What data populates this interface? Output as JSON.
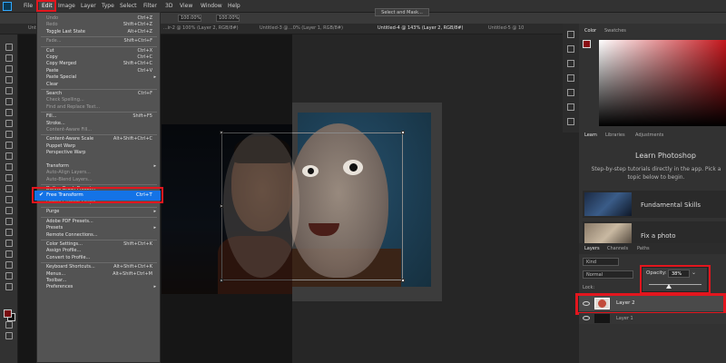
{
  "menubar": {
    "items": [
      "File",
      "Edit",
      "Image",
      "Layer",
      "Type",
      "Select",
      "Filter",
      "3D",
      "View",
      "Window",
      "Help"
    ]
  },
  "options": {
    "zoom_a": "100.00%",
    "zoom_b": "100.00%",
    "select_mask": "Select and Mask..."
  },
  "tabs": [
    {
      "label": "Untitl...",
      "active": false
    },
    {
      "label": "...ir-2 @ 100% (Layer 2, RGB/8#)",
      "active": false
    },
    {
      "label": "Untitled-3 @",
      "active": false
    },
    {
      "label": "...0% (Layer 1, RGB/8#)",
      "active": false
    },
    {
      "label": "Untitled-4 @ 143% (Layer 2, RGB/8#)",
      "active": true
    },
    {
      "label": "Untitled-5 @ 10",
      "active": false
    }
  ],
  "edit_menu": {
    "items": [
      {
        "label": "Undo",
        "shortcut": "Ctrl+Z",
        "dim": true
      },
      {
        "label": "Redo",
        "shortcut": "Shift+Ctrl+Z",
        "dim": true
      },
      {
        "label": "Toggle Last State",
        "shortcut": "Alt+Ctrl+Z",
        "dim": false
      },
      {
        "sep": true
      },
      {
        "label": "Fade...",
        "shortcut": "Shift+Ctrl+F",
        "dim": true
      },
      {
        "sep": true
      },
      {
        "label": "Cut",
        "shortcut": "Ctrl+X",
        "dim": false
      },
      {
        "label": "Copy",
        "shortcut": "Ctrl+C",
        "dim": false
      },
      {
        "label": "Copy Merged",
        "shortcut": "Shift+Ctrl+C",
        "dim": false
      },
      {
        "label": "Paste",
        "shortcut": "Ctrl+V",
        "dim": false
      },
      {
        "label": "Paste Special",
        "shortcut": "",
        "dim": false,
        "sub": true
      },
      {
        "label": "Clear",
        "shortcut": "",
        "dim": false
      },
      {
        "sep": true
      },
      {
        "label": "Search",
        "shortcut": "Ctrl+F",
        "dim": false
      },
      {
        "label": "Check Spelling...",
        "shortcut": "",
        "dim": true
      },
      {
        "label": "Find and Replace Text...",
        "shortcut": "",
        "dim": true
      },
      {
        "sep": true
      },
      {
        "label": "Fill...",
        "shortcut": "Shift+F5",
        "dim": false
      },
      {
        "label": "Stroke...",
        "shortcut": "",
        "dim": false
      },
      {
        "label": "Content-Aware Fill...",
        "shortcut": "",
        "dim": true
      },
      {
        "sep": true
      },
      {
        "label": "Content-Aware Scale",
        "shortcut": "Alt+Shift+Ctrl+C",
        "dim": false
      },
      {
        "label": "Puppet Warp",
        "shortcut": "",
        "dim": false
      },
      {
        "label": "Perspective Warp",
        "shortcut": "",
        "dim": false
      },
      {
        "label": "Free Transform",
        "shortcut": "Ctrl+T",
        "dim": false,
        "highlight": true
      },
      {
        "label": "Transform",
        "shortcut": "",
        "dim": false,
        "sub": true
      },
      {
        "label": "Auto-Align Layers...",
        "shortcut": "",
        "dim": true
      },
      {
        "label": "Auto-Blend Layers...",
        "shortcut": "",
        "dim": true
      },
      {
        "sep": true
      },
      {
        "label": "Define Brush Preset...",
        "shortcut": "",
        "dim": false
      },
      {
        "label": "Define Pattern...",
        "shortcut": "",
        "dim": false
      },
      {
        "label": "Define Custom Shape...",
        "shortcut": "",
        "dim": true
      },
      {
        "sep": true
      },
      {
        "label": "Purge",
        "shortcut": "",
        "dim": false,
        "sub": true
      },
      {
        "sep": true
      },
      {
        "label": "Adobe PDF Presets...",
        "shortcut": "",
        "dim": false
      },
      {
        "label": "Presets",
        "shortcut": "",
        "dim": false,
        "sub": true
      },
      {
        "label": "Remote Connections...",
        "shortcut": "",
        "dim": false
      },
      {
        "sep": true
      },
      {
        "label": "Color Settings...",
        "shortcut": "Shift+Ctrl+K",
        "dim": false
      },
      {
        "label": "Assign Profile...",
        "shortcut": "",
        "dim": false
      },
      {
        "label": "Convert to Profile...",
        "shortcut": "",
        "dim": false
      },
      {
        "sep": true
      },
      {
        "label": "Keyboard Shortcuts...",
        "shortcut": "Alt+Shift+Ctrl+K",
        "dim": false
      },
      {
        "label": "Menus...",
        "shortcut": "Alt+Shift+Ctrl+M",
        "dim": false
      },
      {
        "label": "Toolbar...",
        "shortcut": "",
        "dim": false
      },
      {
        "label": "Preferences",
        "shortcut": "",
        "dim": false,
        "sub": true
      }
    ]
  },
  "color_panel": {
    "tabs": [
      "Color",
      "Swatches"
    ],
    "fg_color": "#8a0d13",
    "bg_color": "#1a1a1a"
  },
  "learn_panel": {
    "tabs": [
      "Learn",
      "Libraries",
      "Adjustments"
    ],
    "title": "Learn Photoshop",
    "description": "Step-by-step tutorials directly in the app. Pick a topic below to begin.",
    "cards": [
      {
        "label": "Fundamental Skills"
      },
      {
        "label": "Fix a photo"
      }
    ]
  },
  "layers_panel": {
    "tabs": [
      "Layers",
      "Channels",
      "Paths"
    ],
    "kind": "Kind",
    "blend_mode": "Normal",
    "opacity_label": "Opacity:",
    "opacity_value": "38%",
    "opacity_fraction": 0.38,
    "lock_label": "Lock:",
    "layers": [
      {
        "name": "Layer 2",
        "selected": true
      },
      {
        "name": "Layer 1",
        "selected": false
      }
    ]
  },
  "colors": {
    "highlight_red": "#e3161e",
    "selection_blue": "#1473e6"
  }
}
